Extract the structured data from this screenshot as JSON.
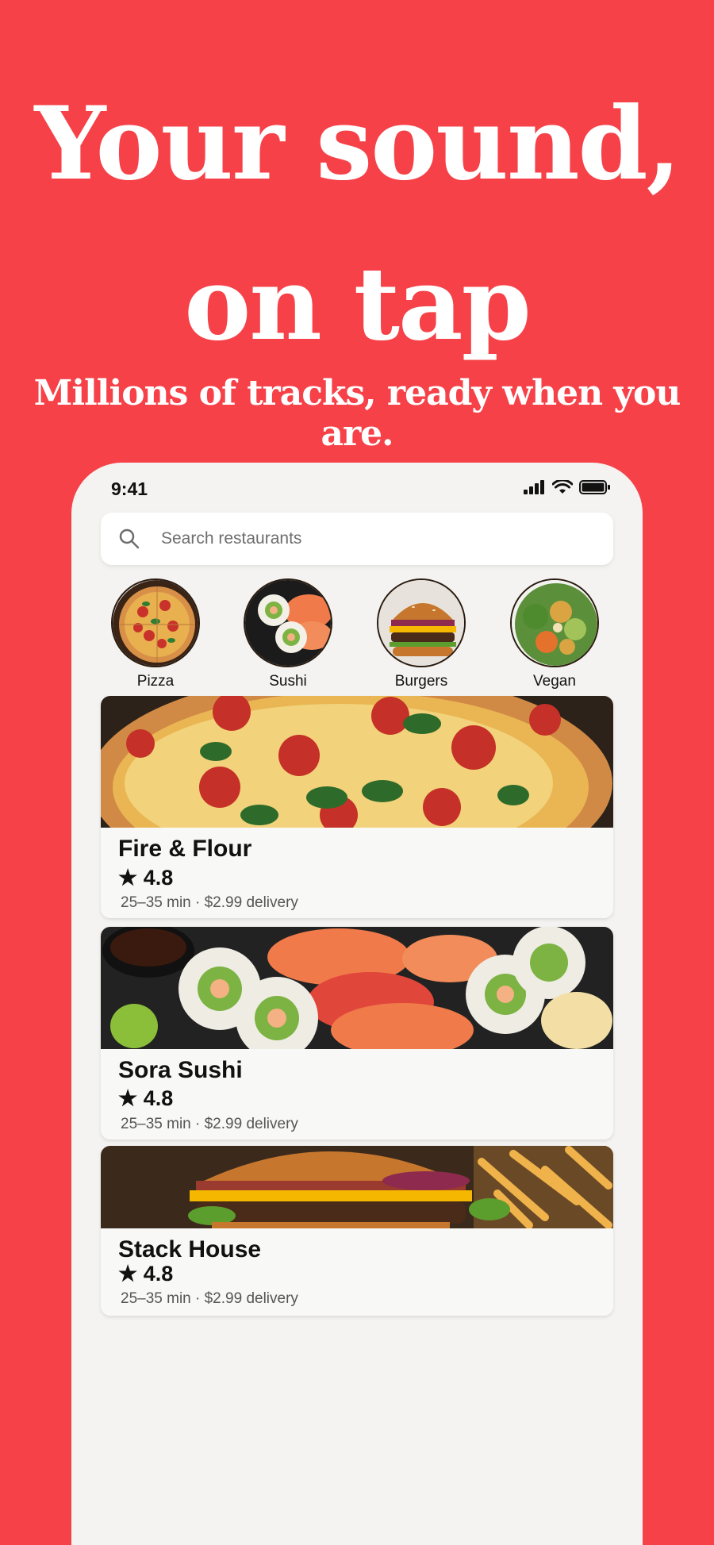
{
  "hero": {
    "title_line1": "Your sound,",
    "title_line2": "on tap",
    "subtitle": "Millions of tracks, ready when you are."
  },
  "status_bar": {
    "time": "9:41"
  },
  "search": {
    "placeholder": "Search restaurants"
  },
  "categories": [
    {
      "label": "Pizza"
    },
    {
      "label": "Sushi"
    },
    {
      "label": "Burgers"
    },
    {
      "label": "Vegan"
    }
  ],
  "restaurants": [
    {
      "name": "Fire & Flour",
      "rating": "★ 4.8",
      "meta": "25–35 min · $2.99 delivery"
    },
    {
      "name": "Sora Sushi",
      "rating": "★ 4.8",
      "meta": "25–35 min · $2.99 delivery"
    },
    {
      "name": "Stack House",
      "rating": "★ 4.8",
      "meta": "25–35 min · $2.99 delivery"
    }
  ],
  "colors": {
    "background": "#F64148",
    "phone": "#F4F3F1",
    "card": "#F8F8F7"
  }
}
